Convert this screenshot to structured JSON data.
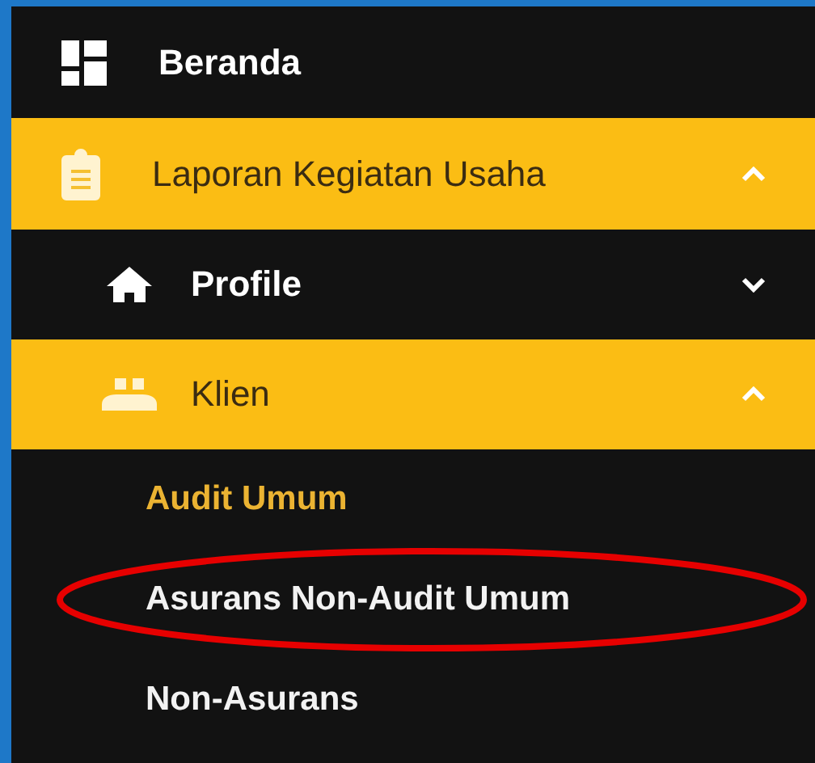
{
  "menu": [
    {
      "label": "Beranda"
    },
    {
      "label": "Laporan Kegiatan Usaha",
      "expanded": true,
      "children": [
        {
          "label": "Profile",
          "expanded": false
        },
        {
          "label": "Klien",
          "expanded": true,
          "children": [
            {
              "label": "Audit Umum",
              "selected": true,
              "circled": false
            },
            {
              "label": "Asurans Non-Audit Umum",
              "selected": false,
              "circled": true
            },
            {
              "label": "Non-Asurans",
              "selected": false,
              "circled": false
            }
          ]
        }
      ]
    }
  ]
}
